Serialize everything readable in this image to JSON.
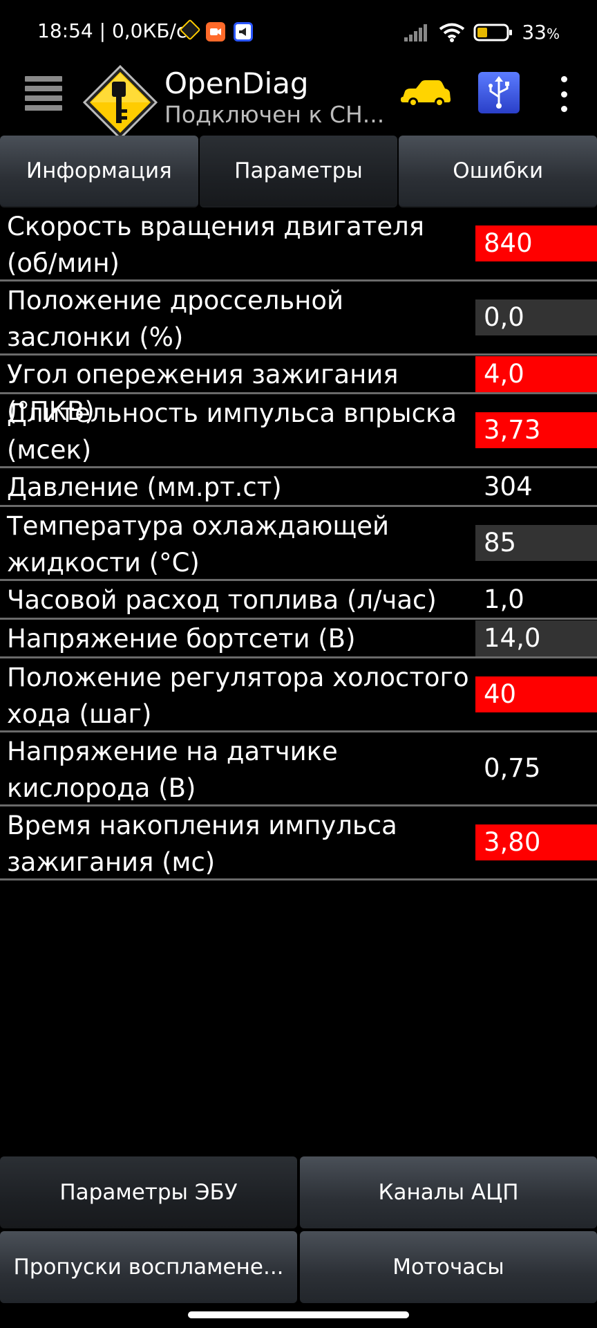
{
  "status": {
    "time": "18:54",
    "speed": "0,0КБ/с",
    "battery_pct": "33",
    "battery_suffix": "%"
  },
  "app": {
    "title": "OpenDiag",
    "subtitle": "Подключен к СН..."
  },
  "tabs": [
    {
      "label": "Информация",
      "active": false
    },
    {
      "label": "Параметры",
      "active": true
    },
    {
      "label": "Ошибки",
      "active": false
    }
  ],
  "params": [
    {
      "label": "Скорость вращения двигателя (об/мин)",
      "value": "840",
      "bg": "red"
    },
    {
      "label": "Положение дроссельной заслонки (%)",
      "value": "0,0",
      "bg": "gray"
    },
    {
      "label": "Угол опережения зажигания (°ПКВ)",
      "value": "4,0",
      "bg": "red"
    },
    {
      "label": "Длительность импульса впрыска (мсек)",
      "value": "3,73",
      "bg": "red"
    },
    {
      "label": "Давление (мм.рт.ст)",
      "value": "304",
      "bg": "none"
    },
    {
      "label": "Температура охлаждающей жидкости (°С)",
      "value": "85",
      "bg": "gray"
    },
    {
      "label": "Часовой расход топлива (л/час)",
      "value": "1,0",
      "bg": "none"
    },
    {
      "label": "Напряжение бортсети (В)",
      "value": "14,0",
      "bg": "gray"
    },
    {
      "label": "Положение регулятора холостого хода (шаг)",
      "value": "40",
      "bg": "red"
    },
    {
      "label": "Напряжение на датчике кислорода (В)",
      "value": "0,75",
      "bg": "none"
    },
    {
      "label": "Время накопления импульса зажигания (мс)",
      "value": "3,80",
      "bg": "red"
    }
  ],
  "bottom_buttons": [
    {
      "label": "Параметры ЭБУ",
      "active": true
    },
    {
      "label": "Каналы АЦП",
      "active": false
    },
    {
      "label": "Пропуски воспламене...",
      "active": false
    },
    {
      "label": "Моточасы",
      "active": false
    }
  ],
  "colors": {
    "value_red": "#ff0000",
    "value_gray": "#333333",
    "car_yellow": "#ffd400"
  }
}
